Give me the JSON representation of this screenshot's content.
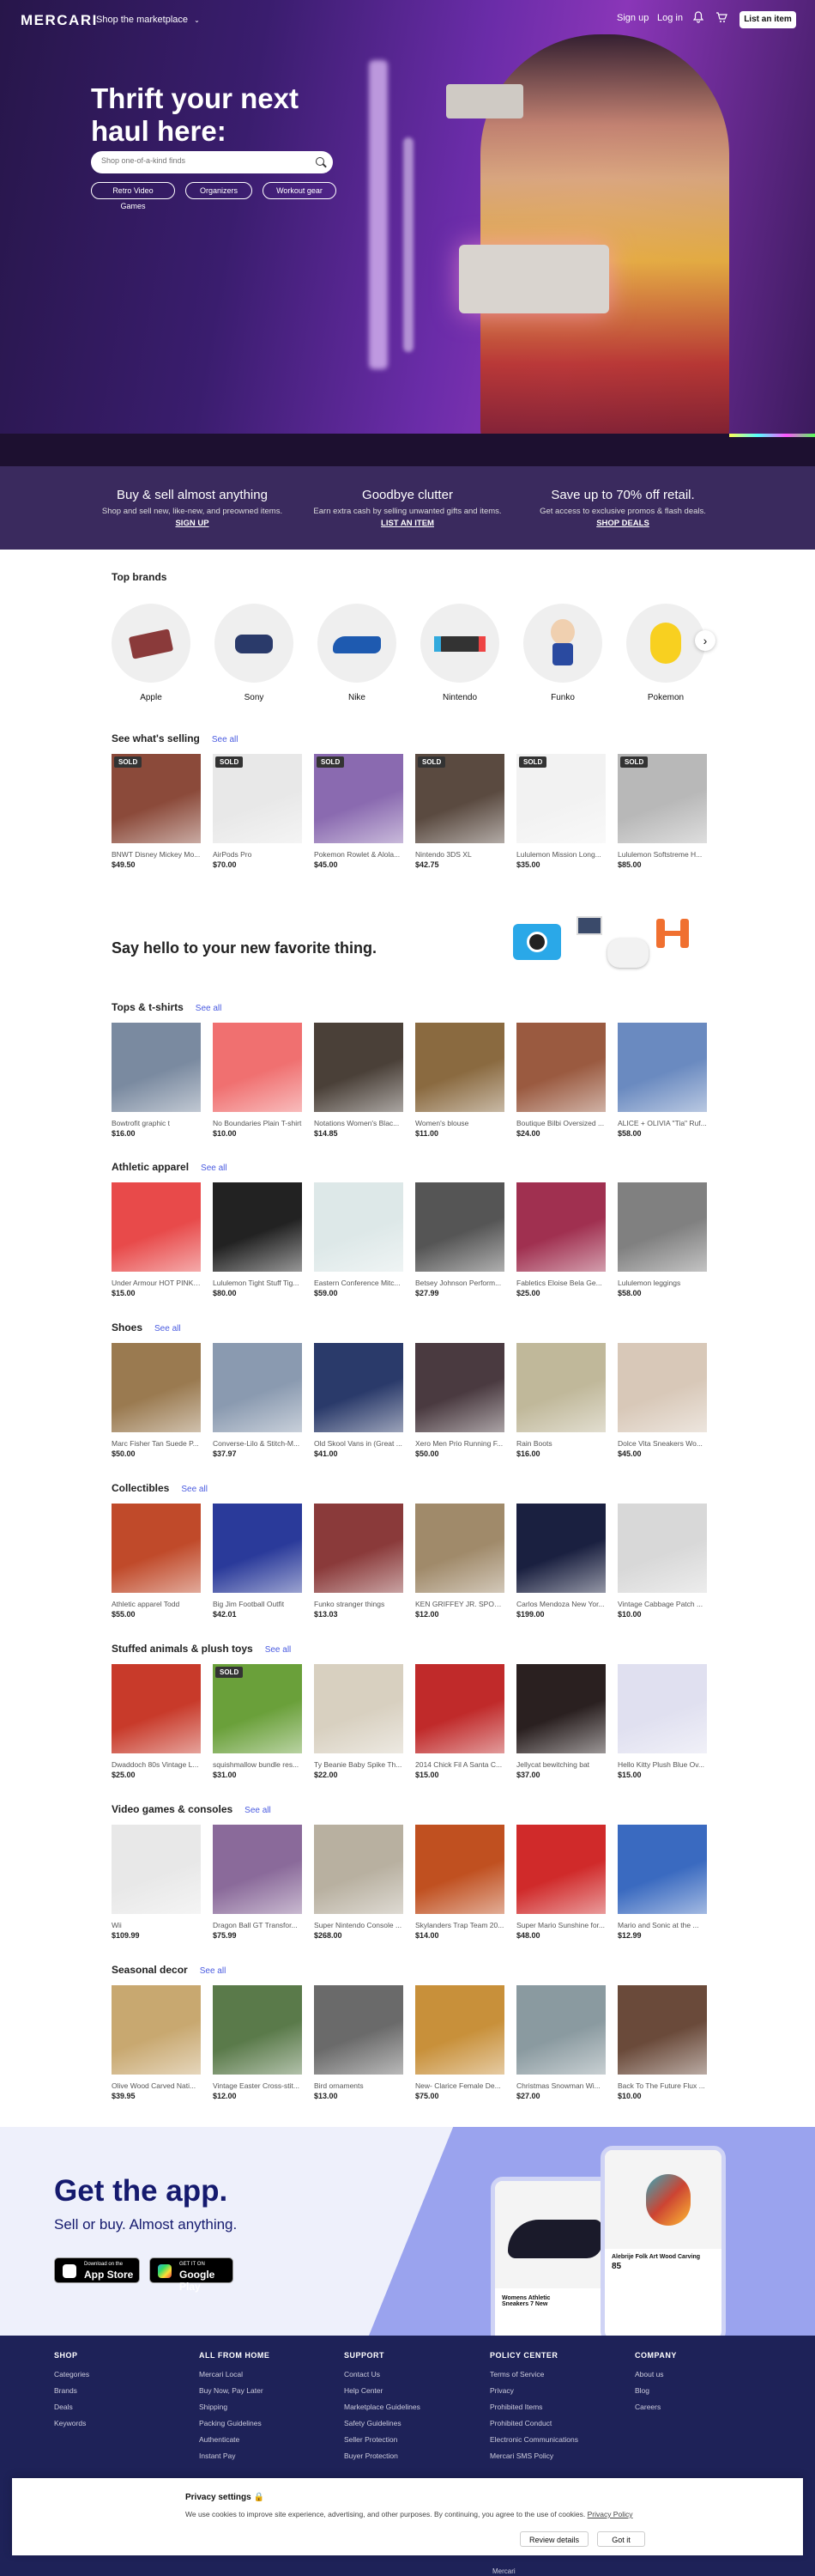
{
  "header": {
    "logo": "MERCARI",
    "shop_menu": "Shop the marketplace",
    "sign_up": "Sign up",
    "log_in": "Log in",
    "list_item": "List an item"
  },
  "hero": {
    "title": "Thrift your next haul here:",
    "search_placeholder": "Shop one-of-a-kind finds",
    "chips": [
      "Retro Video Games",
      "Organizers",
      "Workout gear"
    ]
  },
  "promo": [
    {
      "title": "Buy & sell almost anything",
      "text": "Shop and sell new, like-new, and preowned items.",
      "link": "SIGN UP"
    },
    {
      "title": "Goodbye clutter",
      "text": "Earn extra cash by selling unwanted gifts and items.",
      "link": "LIST AN ITEM"
    },
    {
      "title": "Save up to 70% off retail.",
      "text": "Get access to exclusive promos & flash deals.",
      "link": "SHOP DEALS"
    }
  ],
  "top_brands": {
    "title": "Top brands",
    "brands": [
      "Apple",
      "Sony",
      "Nike",
      "Nintendo",
      "Funko",
      "Pokemon"
    ]
  },
  "see_all": "See all",
  "sold_label": "SOLD",
  "sections": [
    {
      "title": "See what's selling",
      "items": [
        {
          "name": "BNWT Disney Mickey Mo...",
          "price": "$49.50",
          "sold": true,
          "color": "#8b4a3a"
        },
        {
          "name": "AirPods Pro",
          "price": "$70.00",
          "sold": true,
          "color": "#e8e8e8"
        },
        {
          "name": "Pokemon Rowlet & Alola...",
          "price": "$45.00",
          "sold": true,
          "color": "#8a6ab0"
        },
        {
          "name": "Nintendo 3DS XL",
          "price": "$42.75",
          "sold": true,
          "color": "#5a4a40"
        },
        {
          "name": "Lululemon Mission Long...",
          "price": "$35.00",
          "sold": true,
          "color": "#f2f2f2"
        },
        {
          "name": "Lululemon Softstreme H...",
          "price": "$85.00",
          "sold": true,
          "color": "#b8b8b8"
        }
      ]
    },
    {
      "title": "Tops & t-shirts",
      "items": [
        {
          "name": "Bowtrofit graphic t",
          "price": "$16.00",
          "color": "#7a8aa0"
        },
        {
          "name": "No Boundaries Plain T-shirt",
          "price": "$10.00",
          "color": "#f07070"
        },
        {
          "name": "Notations Women's Blac...",
          "price": "$14.85",
          "color": "#4a4038"
        },
        {
          "name": "Women's blouse",
          "price": "$11.00",
          "color": "#8a6a40"
        },
        {
          "name": "Boutique Bilbi Oversized ...",
          "price": "$24.00",
          "color": "#9a5a40"
        },
        {
          "name": "ALICE + OLIVIA \"Tia\" Ruf...",
          "price": "$58.00",
          "color": "#6a8ac0"
        }
      ]
    },
    {
      "title": "Athletic apparel",
      "items": [
        {
          "name": "Under Armour HOT PINK ...",
          "price": "$15.00",
          "color": "#e84a4a"
        },
        {
          "name": "Lululemon Tight Stuff Tig...",
          "price": "$80.00",
          "color": "#222222"
        },
        {
          "name": "Eastern Conference Mitc...",
          "price": "$59.00",
          "color": "#dde8e8"
        },
        {
          "name": "Betsey Johnson Perform...",
          "price": "$27.99",
          "color": "#555555"
        },
        {
          "name": "Fabletics Eloise Bela Ge...",
          "price": "$25.00",
          "color": "#a03050"
        },
        {
          "name": "Lululemon leggings",
          "price": "$58.00",
          "color": "#808080"
        }
      ]
    },
    {
      "title": "Shoes",
      "items": [
        {
          "name": "Marc Fisher Tan Suede P...",
          "price": "$50.00",
          "color": "#9a7a50"
        },
        {
          "name": "Converse-Lilo & Stitch-M...",
          "price": "$37.97",
          "color": "#8a9ab0"
        },
        {
          "name": "Old Skool Vans in (Great ...",
          "price": "$41.00",
          "color": "#2a3a6a"
        },
        {
          "name": "Xero Men Prio Running F...",
          "price": "$50.00",
          "color": "#4a3a40"
        },
        {
          "name": "Rain Boots",
          "price": "$16.00",
          "color": "#c0b89a"
        },
        {
          "name": "Dolce Vita Sneakers Wo...",
          "price": "$45.00",
          "color": "#d8c8b8"
        }
      ]
    },
    {
      "title": "Collectibles",
      "items": [
        {
          "name": "Athletic apparel Todd",
          "price": "$55.00",
          "color": "#c04a2a"
        },
        {
          "name": "Big Jim Football Outfit",
          "price": "$42.01",
          "color": "#2a3a9a"
        },
        {
          "name": "Funko stranger things",
          "price": "$13.03",
          "color": "#8a3a3a"
        },
        {
          "name": "KEN GRIFFEY JR. SPORT...",
          "price": "$12.00",
          "color": "#a08a6a"
        },
        {
          "name": "Carlos Mendoza New Yor...",
          "price": "$199.00",
          "color": "#1a2040"
        },
        {
          "name": "Vintage Cabbage Patch ...",
          "price": "$10.00",
          "color": "#d8d8d8"
        }
      ]
    },
    {
      "title": "Stuffed animals & plush toys",
      "items": [
        {
          "name": "Dwaddoch 80s Vintage L...",
          "price": "$25.00",
          "color": "#c83a2a"
        },
        {
          "name": "squishmallow bundle res...",
          "price": "$31.00",
          "sold": true,
          "color": "#6aa03a"
        },
        {
          "name": "Ty Beanie Baby Spike Th...",
          "price": "$22.00",
          "color": "#d8d0c0"
        },
        {
          "name": "2014 Chick Fil A Santa C...",
          "price": "$15.00",
          "color": "#c02a2a"
        },
        {
          "name": "Jellycat bewitching bat",
          "price": "$37.00",
          "color": "#2a2020"
        },
        {
          "name": "Hello Kitty Plush Blue Ov...",
          "price": "$15.00",
          "color": "#e0e0f0"
        }
      ]
    },
    {
      "title": "Video games & consoles",
      "items": [
        {
          "name": "Wii",
          "price": "$109.99",
          "color": "#e8e8e8"
        },
        {
          "name": "Dragon Ball GT Transfor...",
          "price": "$75.99",
          "color": "#8a6a9a"
        },
        {
          "name": "Super Nintendo Console ...",
          "price": "$268.00",
          "color": "#b8b0a0"
        },
        {
          "name": "Skylanders Trap Team 20...",
          "price": "$14.00",
          "color": "#c05020"
        },
        {
          "name": "Super Mario Sunshine for...",
          "price": "$48.00",
          "color": "#d02a2a"
        },
        {
          "name": "Mario and Sonic at the ...",
          "price": "$12.99",
          "color": "#3a6ac0"
        }
      ]
    },
    {
      "title": "Seasonal decor",
      "items": [
        {
          "name": "Olive Wood Carved Nati...",
          "price": "$39.95",
          "color": "#c8a870"
        },
        {
          "name": "Vintage Easter Cross-stit...",
          "price": "$12.00",
          "color": "#5a7a4a"
        },
        {
          "name": "Bird ornaments",
          "price": "$13.00",
          "color": "#6a6a6a"
        },
        {
          "name": "New- Clarice Female De...",
          "price": "$75.00",
          "color": "#c8903a"
        },
        {
          "name": "Christmas Snowman Wi...",
          "price": "$27.00",
          "color": "#8a9aa0"
        },
        {
          "name": "Back To The Future Flux ...",
          "price": "$10.00",
          "color": "#6a4a3a"
        }
      ]
    }
  ],
  "hello_banner": "Say hello to your new favorite thing.",
  "app": {
    "title": "Get the app.",
    "subtitle": "Sell or buy. Almost anything.",
    "appstore_small": "Download on the",
    "appstore_big": "App Store",
    "googleplay_small": "GET IT ON",
    "googleplay_big": "Google Play",
    "phone1_caption": "Womens Athletic Sneakers 7 New",
    "phone2_caption": "Alebrije Folk Art Wood Carving",
    "phone2_price": "85"
  },
  "footer": [
    {
      "title": "SHOP",
      "links": [
        "Categories",
        "Brands",
        "Deals",
        "Keywords"
      ]
    },
    {
      "title": "ALL FROM HOME",
      "links": [
        "Mercari Local",
        "Buy Now, Pay Later",
        "Shipping",
        "Packing Guidelines",
        "Authenticate",
        "Instant Pay"
      ]
    },
    {
      "title": "SUPPORT",
      "links": [
        "Contact Us",
        "Help Center",
        "Marketplace Guidelines",
        "Safety Guidelines",
        "Seller Protection",
        "Buyer Protection"
      ]
    },
    {
      "title": "POLICY CENTER",
      "links": [
        "Terms of Service",
        "Privacy",
        "Prohibited Items",
        "Prohibited Conduct",
        "Electronic Communications",
        "Mercari SMS Policy"
      ]
    },
    {
      "title": "COMPANY",
      "links": [
        "About us",
        "Blog",
        "Careers"
      ]
    }
  ],
  "cookie": {
    "title": "Privacy settings",
    "text": "We use cookies to improve site experience, advertising, and other purposes. By continuing, you agree to the use of cookies.",
    "link": "Privacy Policy",
    "details": "Review details",
    "ok": "Got it"
  },
  "footer_extra": "Mercari"
}
